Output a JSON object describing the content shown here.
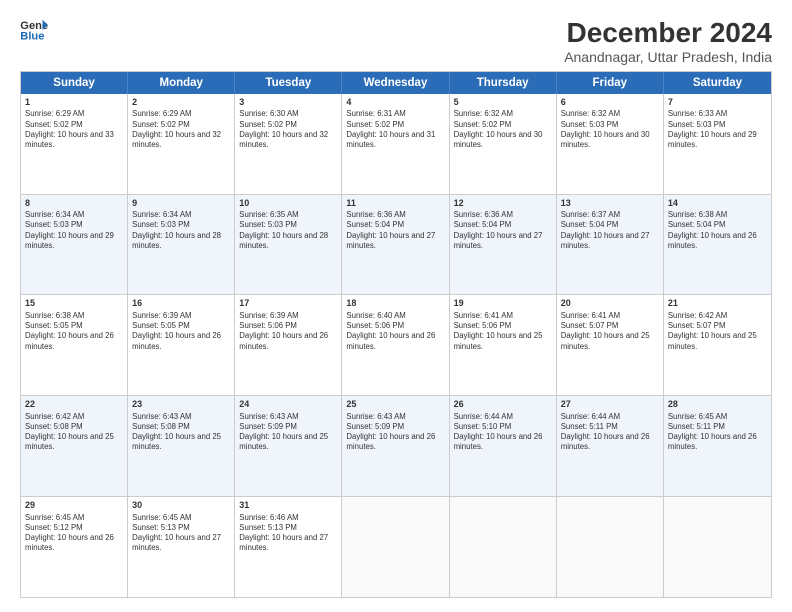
{
  "logo": {
    "line1": "General",
    "line2": "Blue"
  },
  "title": "December 2024",
  "subtitle": "Anandnagar, Uttar Pradesh, India",
  "header_days": [
    "Sunday",
    "Monday",
    "Tuesday",
    "Wednesday",
    "Thursday",
    "Friday",
    "Saturday"
  ],
  "rows": [
    [
      {
        "day": "1",
        "sunrise": "Sunrise: 6:29 AM",
        "sunset": "Sunset: 5:02 PM",
        "daylight": "Daylight: 10 hours and 33 minutes."
      },
      {
        "day": "2",
        "sunrise": "Sunrise: 6:29 AM",
        "sunset": "Sunset: 5:02 PM",
        "daylight": "Daylight: 10 hours and 32 minutes."
      },
      {
        "day": "3",
        "sunrise": "Sunrise: 6:30 AM",
        "sunset": "Sunset: 5:02 PM",
        "daylight": "Daylight: 10 hours and 32 minutes."
      },
      {
        "day": "4",
        "sunrise": "Sunrise: 6:31 AM",
        "sunset": "Sunset: 5:02 PM",
        "daylight": "Daylight: 10 hours and 31 minutes."
      },
      {
        "day": "5",
        "sunrise": "Sunrise: 6:32 AM",
        "sunset": "Sunset: 5:02 PM",
        "daylight": "Daylight: 10 hours and 30 minutes."
      },
      {
        "day": "6",
        "sunrise": "Sunrise: 6:32 AM",
        "sunset": "Sunset: 5:03 PM",
        "daylight": "Daylight: 10 hours and 30 minutes."
      },
      {
        "day": "7",
        "sunrise": "Sunrise: 6:33 AM",
        "sunset": "Sunset: 5:03 PM",
        "daylight": "Daylight: 10 hours and 29 minutes."
      }
    ],
    [
      {
        "day": "8",
        "sunrise": "Sunrise: 6:34 AM",
        "sunset": "Sunset: 5:03 PM",
        "daylight": "Daylight: 10 hours and 29 minutes."
      },
      {
        "day": "9",
        "sunrise": "Sunrise: 6:34 AM",
        "sunset": "Sunset: 5:03 PM",
        "daylight": "Daylight: 10 hours and 28 minutes."
      },
      {
        "day": "10",
        "sunrise": "Sunrise: 6:35 AM",
        "sunset": "Sunset: 5:03 PM",
        "daylight": "Daylight: 10 hours and 28 minutes."
      },
      {
        "day": "11",
        "sunrise": "Sunrise: 6:36 AM",
        "sunset": "Sunset: 5:04 PM",
        "daylight": "Daylight: 10 hours and 27 minutes."
      },
      {
        "day": "12",
        "sunrise": "Sunrise: 6:36 AM",
        "sunset": "Sunset: 5:04 PM",
        "daylight": "Daylight: 10 hours and 27 minutes."
      },
      {
        "day": "13",
        "sunrise": "Sunrise: 6:37 AM",
        "sunset": "Sunset: 5:04 PM",
        "daylight": "Daylight: 10 hours and 27 minutes."
      },
      {
        "day": "14",
        "sunrise": "Sunrise: 6:38 AM",
        "sunset": "Sunset: 5:04 PM",
        "daylight": "Daylight: 10 hours and 26 minutes."
      }
    ],
    [
      {
        "day": "15",
        "sunrise": "Sunrise: 6:38 AM",
        "sunset": "Sunset: 5:05 PM",
        "daylight": "Daylight: 10 hours and 26 minutes."
      },
      {
        "day": "16",
        "sunrise": "Sunrise: 6:39 AM",
        "sunset": "Sunset: 5:05 PM",
        "daylight": "Daylight: 10 hours and 26 minutes."
      },
      {
        "day": "17",
        "sunrise": "Sunrise: 6:39 AM",
        "sunset": "Sunset: 5:06 PM",
        "daylight": "Daylight: 10 hours and 26 minutes."
      },
      {
        "day": "18",
        "sunrise": "Sunrise: 6:40 AM",
        "sunset": "Sunset: 5:06 PM",
        "daylight": "Daylight: 10 hours and 26 minutes."
      },
      {
        "day": "19",
        "sunrise": "Sunrise: 6:41 AM",
        "sunset": "Sunset: 5:06 PM",
        "daylight": "Daylight: 10 hours and 25 minutes."
      },
      {
        "day": "20",
        "sunrise": "Sunrise: 6:41 AM",
        "sunset": "Sunset: 5:07 PM",
        "daylight": "Daylight: 10 hours and 25 minutes."
      },
      {
        "day": "21",
        "sunrise": "Sunrise: 6:42 AM",
        "sunset": "Sunset: 5:07 PM",
        "daylight": "Daylight: 10 hours and 25 minutes."
      }
    ],
    [
      {
        "day": "22",
        "sunrise": "Sunrise: 6:42 AM",
        "sunset": "Sunset: 5:08 PM",
        "daylight": "Daylight: 10 hours and 25 minutes."
      },
      {
        "day": "23",
        "sunrise": "Sunrise: 6:43 AM",
        "sunset": "Sunset: 5:08 PM",
        "daylight": "Daylight: 10 hours and 25 minutes."
      },
      {
        "day": "24",
        "sunrise": "Sunrise: 6:43 AM",
        "sunset": "Sunset: 5:09 PM",
        "daylight": "Daylight: 10 hours and 25 minutes."
      },
      {
        "day": "25",
        "sunrise": "Sunrise: 6:43 AM",
        "sunset": "Sunset: 5:09 PM",
        "daylight": "Daylight: 10 hours and 26 minutes."
      },
      {
        "day": "26",
        "sunrise": "Sunrise: 6:44 AM",
        "sunset": "Sunset: 5:10 PM",
        "daylight": "Daylight: 10 hours and 26 minutes."
      },
      {
        "day": "27",
        "sunrise": "Sunrise: 6:44 AM",
        "sunset": "Sunset: 5:11 PM",
        "daylight": "Daylight: 10 hours and 26 minutes."
      },
      {
        "day": "28",
        "sunrise": "Sunrise: 6:45 AM",
        "sunset": "Sunset: 5:11 PM",
        "daylight": "Daylight: 10 hours and 26 minutes."
      }
    ],
    [
      {
        "day": "29",
        "sunrise": "Sunrise: 6:45 AM",
        "sunset": "Sunset: 5:12 PM",
        "daylight": "Daylight: 10 hours and 26 minutes."
      },
      {
        "day": "30",
        "sunrise": "Sunrise: 6:45 AM",
        "sunset": "Sunset: 5:13 PM",
        "daylight": "Daylight: 10 hours and 27 minutes."
      },
      {
        "day": "31",
        "sunrise": "Sunrise: 6:46 AM",
        "sunset": "Sunset: 5:13 PM",
        "daylight": "Daylight: 10 hours and 27 minutes."
      },
      null,
      null,
      null,
      null
    ]
  ]
}
